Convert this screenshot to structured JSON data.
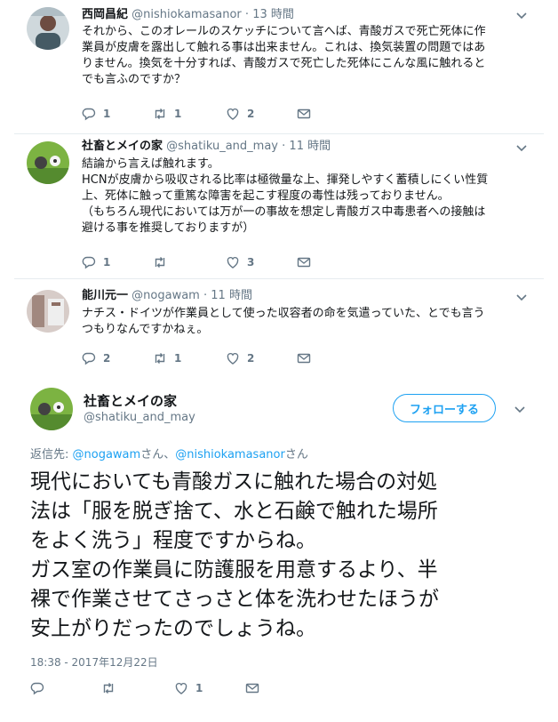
{
  "tweets": [
    {
      "name": "西岡昌紀",
      "handle": "@nishiokamasanor",
      "dot": "·",
      "time": "13 時間",
      "text": "それから、このオレールのスケッチについて言へば、青酸ガスで死亡死体に作\n業員が皮膚を露出して触れる事は出来ません。これは、換気装置の問題ではあ\nりません。換気を十分すれば、青酸ガスで死亡した死体にこんな風に触れると\nでも言ふのですか？",
      "replies": "1",
      "retweets": "1",
      "likes": "2"
    },
    {
      "name": "社畜とメイの家",
      "handle": "@shatiku_and_may",
      "dot": "·",
      "time": "11 時間",
      "text": "結論から言えば触れます。\nHCNが皮膚から吸収される比率は極微量な上、揮発しやすく蓄積しにくい性質\n上、死体に触って重篤な障害を起こす程度の毒性は残っておりません。\n（もちろん現代においては万が一の事故を想定し青酸ガス中毒患者への接触は\n避ける事を推奨しておりますが）",
      "replies": "1",
      "retweets": "",
      "likes": "3"
    },
    {
      "name": "能川元一",
      "handle": "@nogawam",
      "dot": "·",
      "time": "11 時間",
      "text": "ナチス・ドイツが作業員として使った収容者の命を気遣っていた、とでも言う\nつもりなんですかねぇ。",
      "replies": "2",
      "retweets": "1",
      "likes": "2"
    }
  ],
  "main": {
    "name": "社畜とメイの家",
    "handle": "@shatiku_and_may",
    "follow_label": "フォローする",
    "reply_prefix": "返信先: ",
    "reply_user1": "@nogawam",
    "reply_mid": "さん、",
    "reply_user2": "@nishiokamasanor",
    "reply_suffix": "さん",
    "text": "現代においても青酸ガスに触れた場合の対処\n法は「服を脱ぎ捨て、水と石鹸で触れた場所\nをよく洗う」程度ですからね。\nガス室の作業員に防護服を用意するより、半\n裸で作業させてさっさと体を洗わせたほうが\n安上がりだったのでしょうね。",
    "timestamp": "18:38 - 2017年12月22日",
    "replies": "",
    "retweets": "",
    "likes": "1"
  },
  "colors": {
    "accent": "#1da1f2",
    "muted": "#657786",
    "text": "#14171a",
    "divider": "#e6ecf0"
  },
  "icons": [
    "reply-icon",
    "retweet-icon",
    "like-icon",
    "dm-icon",
    "chevron-down-icon"
  ]
}
